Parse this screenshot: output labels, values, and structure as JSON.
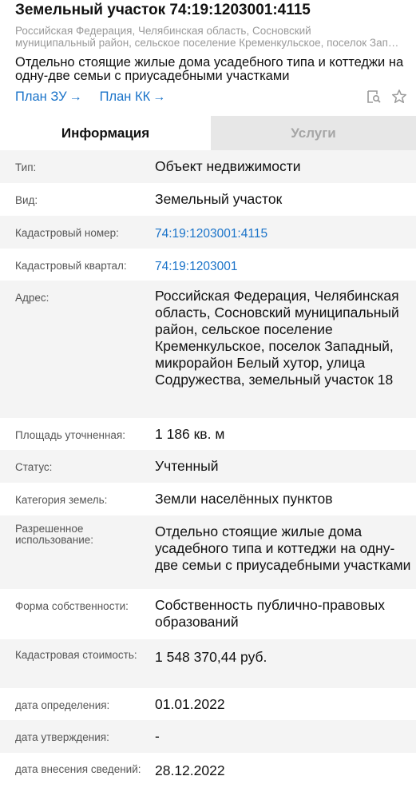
{
  "header": {
    "title": "Земельный участок 74:19:1203001:4115",
    "address_line1": "Российская Федерация, Челябинская область, Сосновский",
    "address_line2": "муниципальный район, сельское поселение Кременкульское, поселок Западный",
    "purpose": "Отдельно стоящие жилые дома усадебного типа и коттеджи на одну-две семьи с приусадебными участками",
    "link_plan_zu": "План ЗУ",
    "link_plan_kk": "План КК",
    "arrow": "→"
  },
  "tools": {
    "search_icon": "search-map-icon",
    "star_icon": "star-icon"
  },
  "tabs": {
    "info": "Информация",
    "services": "Услуги"
  },
  "rows": [
    {
      "label": "Тип:",
      "value": "Объект недвижимости"
    },
    {
      "label": "Вид:",
      "value": "Земельный участок"
    },
    {
      "label": "Кадастровый номер:",
      "value": "74:19:1203001:4115",
      "link": true
    },
    {
      "label": "Кадастровый квартал:",
      "value": "74:19:1203001",
      "link": true
    },
    {
      "label": "Адрес:",
      "value": "Российская Федерация, Челябинская область, Сосновский муниципальный район, сельское поселение Кременкульское, поселок Западный, микрорайон Белый хутор, улица Содружества, земельный участок 18"
    },
    {
      "label": "Площадь уточненная:",
      "value": "1 186 кв. м"
    },
    {
      "label": "Статус:",
      "value": "Учтенный"
    },
    {
      "label": "Категория земель:",
      "value": "Земли населённых пунктов"
    },
    {
      "label": "Разрешенное использование:",
      "value": "Отдельно стоящие жилые дома усадебного типа и коттеджи на одну-две семьи с приусадебными участками"
    },
    {
      "label": "Форма собственности:",
      "value": "Собственность публично-правовых образований"
    },
    {
      "label": "Кадастровая стоимость:",
      "value": "1 548 370,44 руб."
    },
    {
      "label": "дата определения:",
      "value": "01.01.2022"
    },
    {
      "label": "дата утверждения:",
      "value": "-"
    },
    {
      "label": "дата внесения сведений:",
      "value": "28.12.2022"
    }
  ]
}
